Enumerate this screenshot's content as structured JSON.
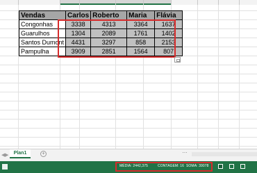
{
  "columns": {
    "selected_count": 4,
    "widths": [
      26,
      60,
      28,
      52,
      40,
      40,
      38,
      30,
      30,
      26
    ]
  },
  "table": {
    "headers": [
      "Vendas",
      "Carlos",
      "Roberto",
      "Maria",
      "Flávia"
    ],
    "rows": [
      {
        "name": "Congonhas",
        "values": [
          "3338",
          "4313",
          "3364",
          "1637"
        ]
      },
      {
        "name": "Guarulhos",
        "values": [
          "1304",
          "2089",
          "1761",
          "1402"
        ]
      },
      {
        "name": "Santos Dumont",
        "values": [
          "4431",
          "3297",
          "858",
          "2153"
        ]
      },
      {
        "name": "Pampulha",
        "values": [
          "3909",
          "2851",
          "1564",
          "807"
        ]
      }
    ]
  },
  "sheet": {
    "tab_label": "Plan1",
    "add_sheet_label": "+",
    "nav_prev": "◀",
    "nav_next": "▶",
    "more": "⋯"
  },
  "status": {
    "average": "MÉDIA: 2442,375",
    "count": "CONTAGEM: 16",
    "sum": "SOMA: 39078"
  },
  "colors": {
    "accent": "#217346",
    "highlight": "#d62b2b"
  },
  "icons": [
    "ready-icon",
    "quick-analysis-icon",
    "normal-view-icon",
    "page-layout-icon",
    "page-break-icon"
  ]
}
